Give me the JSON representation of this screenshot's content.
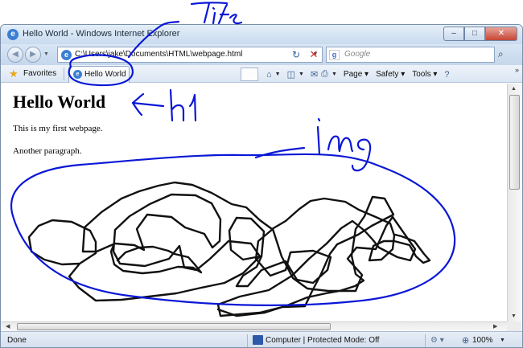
{
  "window": {
    "title": "Hello World - Windows Internet Explorer",
    "minimize_glyph": "–",
    "maximize_glyph": "□",
    "close_glyph": "✕"
  },
  "address_bar": {
    "url": "C:\\Users\\jake\\Documents\\HTML\\webpage.html",
    "refresh_glyph": "↻",
    "stop_glyph": "✕"
  },
  "search": {
    "placeholder": "Google",
    "engine_glyph": "g",
    "button_glyph": "⌕"
  },
  "favorites_bar": {
    "favorites_label": "Favorites",
    "tab_label": "Hello World"
  },
  "command_bar": {
    "home_glyph": "⌂",
    "feeds_glyph": "◫",
    "mail_glyph": "✉",
    "print_glyph": "⎙",
    "page_label": "Page",
    "safety_label": "Safety",
    "tools_label": "Tools",
    "help_glyph": "?",
    "more_glyph": "»"
  },
  "page": {
    "heading": "Hello World",
    "paragraph1": "This is my first webpage.",
    "paragraph2": "Another paragraph."
  },
  "status_bar": {
    "status": "Done",
    "zone": "Computer | Protected Mode: Off",
    "zoom": "100%"
  },
  "annotations": {
    "title_label": "Title",
    "h1_label": "h1",
    "img_label": "img",
    "color": "#0a17d6"
  }
}
